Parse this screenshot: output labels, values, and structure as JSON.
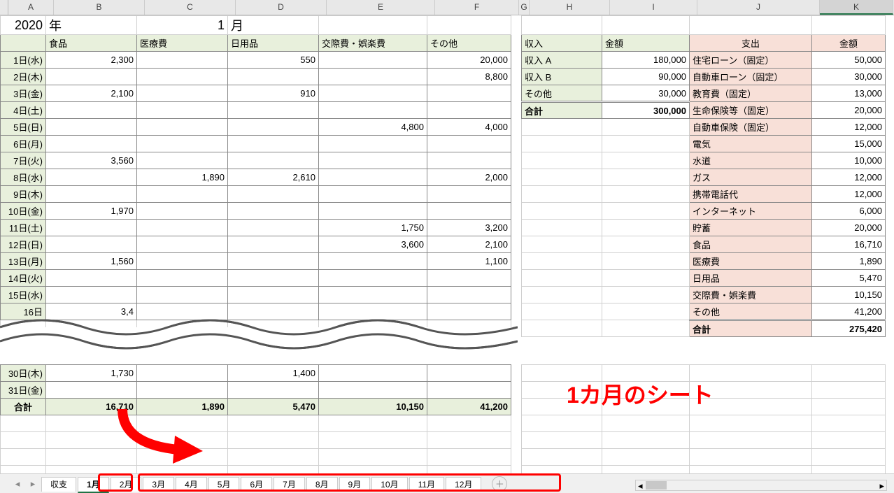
{
  "cols": {
    "A": 65,
    "B": 130,
    "C": 130,
    "D": 130,
    "E": 155,
    "F": 120,
    "G": 15,
    "H": 115,
    "I": 125,
    "J": 175,
    "K": 105
  },
  "year": "2020",
  "year_lbl": "年",
  "month": "1",
  "month_lbl": "月",
  "exp_headers": [
    "食品",
    "医療費",
    "日用品",
    "交際費・娯楽費",
    "その他"
  ],
  "days": [
    {
      "d": "1日(水)",
      "v": [
        "2,300",
        "",
        "550",
        "",
        "20,000"
      ]
    },
    {
      "d": "2日(木)",
      "v": [
        "",
        "",
        "",
        "",
        "8,800"
      ]
    },
    {
      "d": "3日(金)",
      "v": [
        "2,100",
        "",
        "910",
        "",
        ""
      ]
    },
    {
      "d": "4日(土)",
      "v": [
        "",
        "",
        "",
        "",
        ""
      ]
    },
    {
      "d": "5日(日)",
      "v": [
        "",
        "",
        "",
        "4,800",
        "4,000"
      ]
    },
    {
      "d": "6日(月)",
      "v": [
        "",
        "",
        "",
        "",
        ""
      ]
    },
    {
      "d": "7日(火)",
      "v": [
        "3,560",
        "",
        "",
        "",
        ""
      ]
    },
    {
      "d": "8日(水)",
      "v": [
        "",
        "1,890",
        "2,610",
        "",
        "2,000"
      ]
    },
    {
      "d": "9日(木)",
      "v": [
        "",
        "",
        "",
        "",
        ""
      ]
    },
    {
      "d": "10日(金)",
      "v": [
        "1,970",
        "",
        "",
        "",
        ""
      ]
    },
    {
      "d": "11日(土)",
      "v": [
        "",
        "",
        "",
        "1,750",
        "3,200"
      ]
    },
    {
      "d": "12日(日)",
      "v": [
        "",
        "",
        "",
        "3,600",
        "2,100"
      ]
    },
    {
      "d": "13日(月)",
      "v": [
        "1,560",
        "",
        "",
        "",
        "1,100"
      ]
    },
    {
      "d": "14日(火)",
      "v": [
        "",
        "",
        "",
        "",
        ""
      ]
    },
    {
      "d": "15日(水)",
      "v": [
        "",
        "",
        "",
        "",
        ""
      ]
    },
    {
      "d": "16日",
      "v": [
        "3,4",
        "",
        "",
        "",
        ""
      ]
    }
  ],
  "days2": [
    {
      "d": "30日(木)",
      "v": [
        "1,730",
        "",
        "1,400",
        "",
        ""
      ]
    },
    {
      "d": "31日(金)",
      "v": [
        "",
        "",
        "",
        "",
        ""
      ]
    }
  ],
  "totals": {
    "lbl": "合計",
    "v": [
      "16,710",
      "1,890",
      "5,470",
      "10,150",
      "41,200"
    ]
  },
  "income": {
    "hdr": [
      "収入",
      "金額"
    ],
    "rows": [
      [
        "収入 A",
        "180,000"
      ],
      [
        "収入 B",
        "90,000"
      ],
      [
        "その他",
        "30,000"
      ]
    ],
    "total": [
      "合計",
      "300,000"
    ]
  },
  "outgo": {
    "hdr": [
      "支出",
      "金額"
    ],
    "rows": [
      [
        "住宅ローン（固定）",
        "50,000"
      ],
      [
        "自動車ローン（固定）",
        "30,000"
      ],
      [
        "教育費（固定）",
        "13,000"
      ],
      [
        "生命保険等（固定）",
        "20,000"
      ],
      [
        "自動車保険（固定）",
        "12,000"
      ],
      [
        "電気",
        "15,000"
      ],
      [
        "水道",
        "10,000"
      ],
      [
        "ガス",
        "12,000"
      ],
      [
        "携帯電話代",
        "12,000"
      ],
      [
        "インターネット",
        "6,000"
      ],
      [
        "貯蓄",
        "20,000"
      ],
      [
        "食品",
        "16,710"
      ],
      [
        "医療費",
        "1,890"
      ],
      [
        "日用品",
        "5,470"
      ],
      [
        "交際費・娯楽費",
        "10,150"
      ],
      [
        "その他",
        "41,200"
      ]
    ],
    "total": [
      "合計",
      "275,420"
    ]
  },
  "annotation": "1カ月のシート",
  "tabs": [
    "収支",
    "1月",
    "2月",
    "3月",
    "4月",
    "5月",
    "6月",
    "7月",
    "8月",
    "9月",
    "10月",
    "11月",
    "12月"
  ],
  "active_tab": "1月"
}
